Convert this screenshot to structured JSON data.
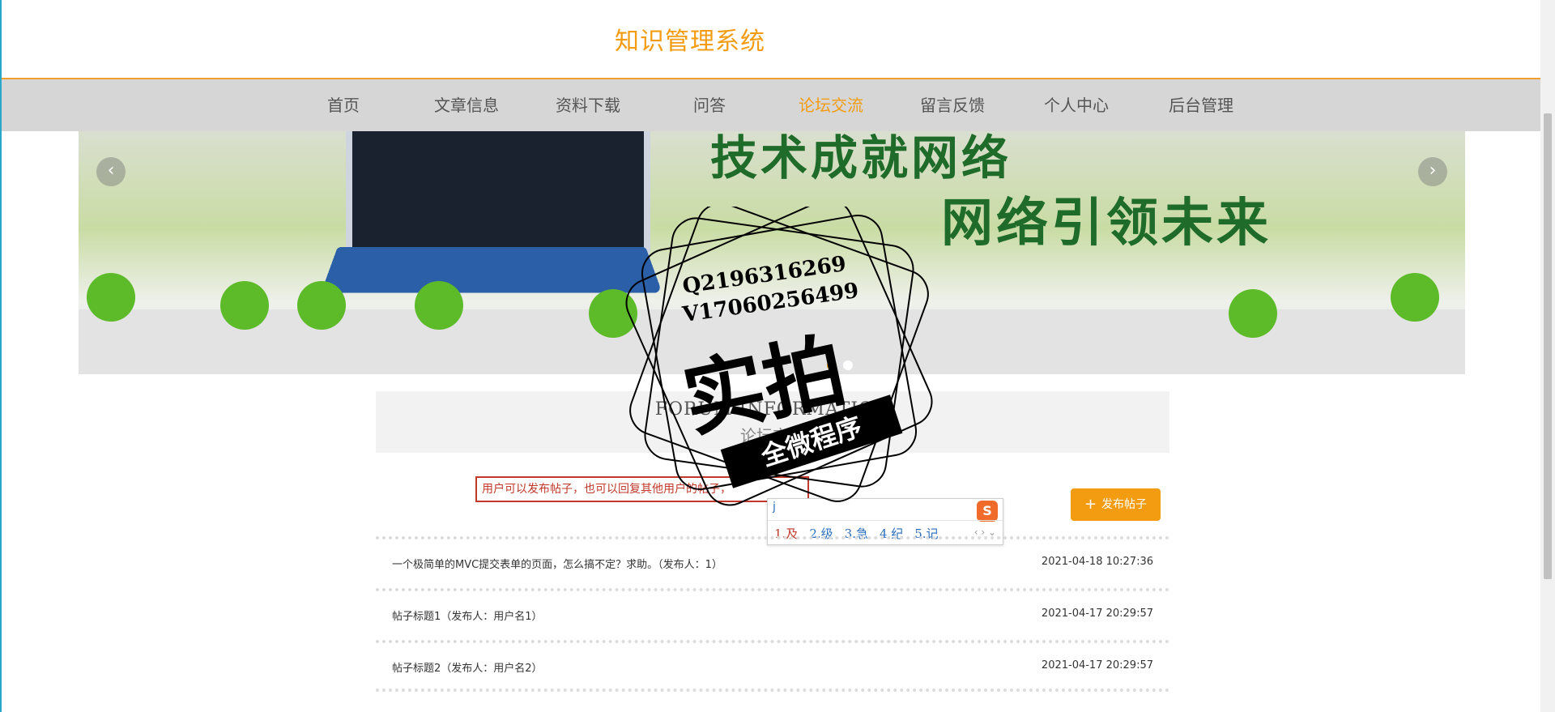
{
  "site": {
    "title": "知识管理系统"
  },
  "nav": {
    "items": [
      {
        "label": "首页"
      },
      {
        "label": "文章信息"
      },
      {
        "label": "资料下载"
      },
      {
        "label": "问答"
      },
      {
        "label": "论坛交流"
      },
      {
        "label": "留言反馈"
      },
      {
        "label": "个人中心"
      },
      {
        "label": "后台管理"
      }
    ],
    "active_index": 4,
    "active_color": "#f39c12"
  },
  "banner": {
    "slogan1": "技术成就网络",
    "slogan2": "网络引领未来",
    "prev_icon": "chevron-left-icon",
    "next_icon": "chevron-right-icon",
    "slide_count": 2,
    "active_slide": 0
  },
  "section": {
    "title_en": "FORUM INFORMATION",
    "title_cn": "论坛交流"
  },
  "tip": {
    "text": "用户可以发布帖子，也可以回复其他用户的帖子，"
  },
  "post_button": {
    "label": "发布帖子",
    "icon": "plus-icon"
  },
  "ime": {
    "composition": "j",
    "candidates": [
      "1.及",
      "2.级",
      "3.急",
      "4.纪",
      "5.记"
    ],
    "logo": "S"
  },
  "posts": [
    {
      "title": "一个极简单的MVC提交表单的页面，怎么搞不定？求助。（发布人：1）",
      "time": "2021-04-18 10:27:36"
    },
    {
      "title": "帖子标题1（发布人：用户名1）",
      "time": "2021-04-17 20:29:57"
    },
    {
      "title": "帖子标题2（发布人：用户名2）",
      "time": "2021-04-17 20:29:57"
    }
  ],
  "watermark": {
    "line1": "Q2196316269",
    "line2": "V17060256499",
    "big": "实拍",
    "band": "全微程序"
  }
}
